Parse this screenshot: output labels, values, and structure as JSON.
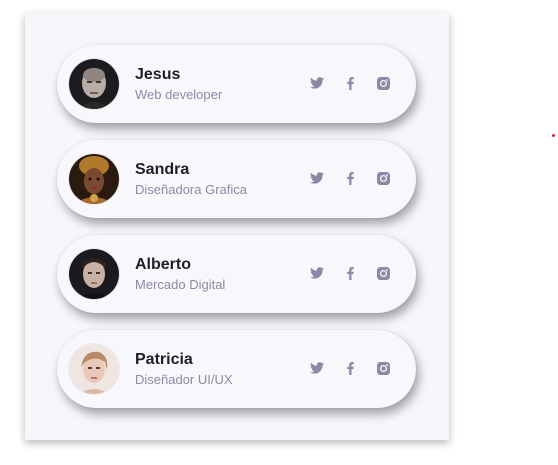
{
  "colors": {
    "icon": "#8a8aa6",
    "panel": "#f7f6fb",
    "card": "#f8f8fc",
    "name": "#1f1f2a",
    "role": "#8a8aa6",
    "accent_dot": "#c2323a"
  },
  "profiles": [
    {
      "name": "Jesus",
      "role": "Web developer",
      "icons": [
        "twitter-icon",
        "facebook-icon",
        "instagram-icon"
      ]
    },
    {
      "name": "Sandra",
      "role": "Diseñadora Grafica",
      "icons": [
        "twitter-icon",
        "facebook-icon",
        "instagram-icon"
      ]
    },
    {
      "name": "Alberto",
      "role": "Mercado Digital",
      "icons": [
        "twitter-icon",
        "facebook-icon",
        "instagram-icon"
      ]
    },
    {
      "name": "Patricia",
      "role": "Diseñador UI/UX",
      "icons": [
        "twitter-icon",
        "facebook-icon",
        "instagram-icon"
      ]
    }
  ]
}
